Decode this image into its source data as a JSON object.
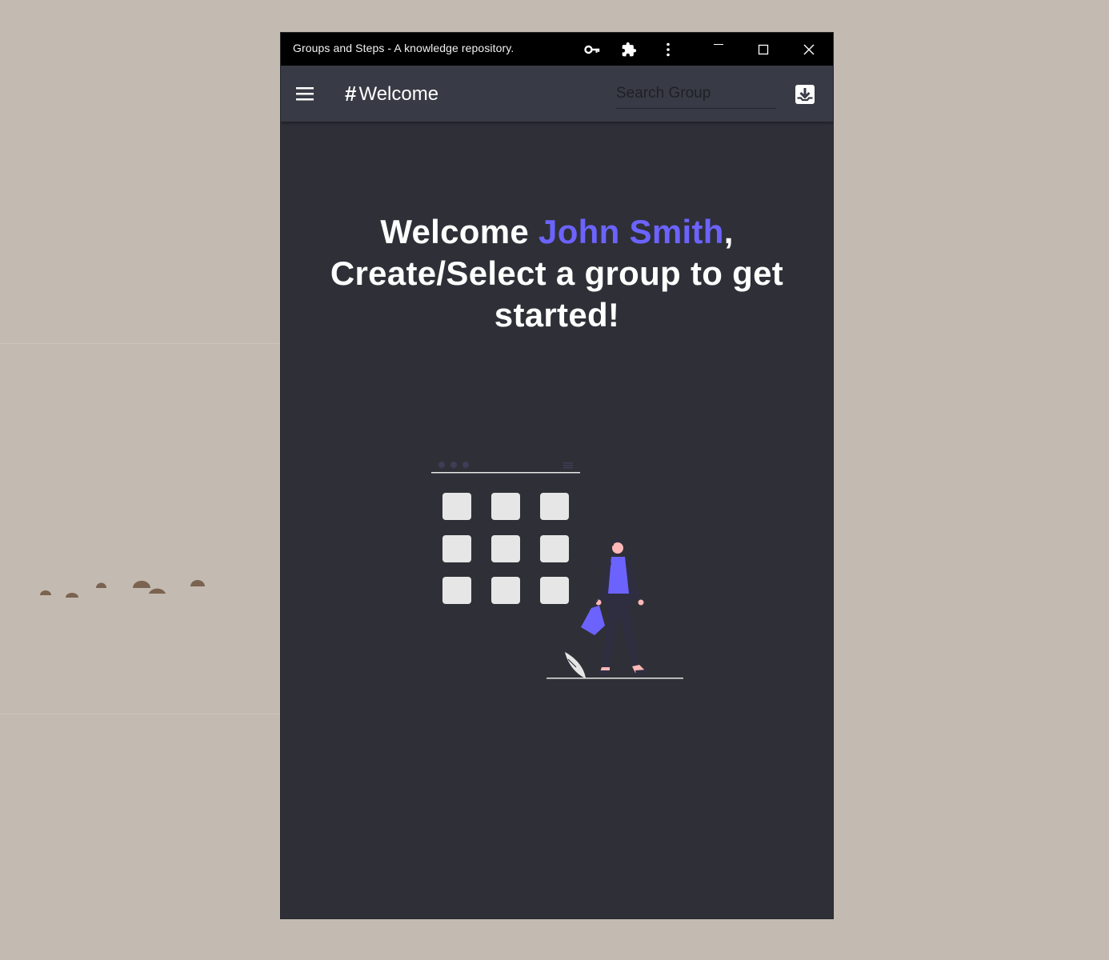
{
  "window": {
    "title": "Groups and Steps - A knowledge repository."
  },
  "titlebar_icons": [
    "key-icon",
    "puzzle-icon",
    "more-vert-icon",
    "minimize-icon",
    "maximize-icon",
    "close-icon"
  ],
  "appbar": {
    "title_prefix": "#",
    "title": "Welcome",
    "search_placeholder": "Search Group",
    "search_value": ""
  },
  "main": {
    "greeting": "Welcome",
    "user_name": "John Smith",
    "greeting_suffix": ",",
    "instruction": "Create/Select a group to get started!"
  },
  "colors": {
    "accent": "#6c63ff",
    "window_bg": "#2f3037",
    "appbar_bg": "#383b45",
    "titlebar_bg": "#000000",
    "desktop_bg": "#c3bab1"
  }
}
